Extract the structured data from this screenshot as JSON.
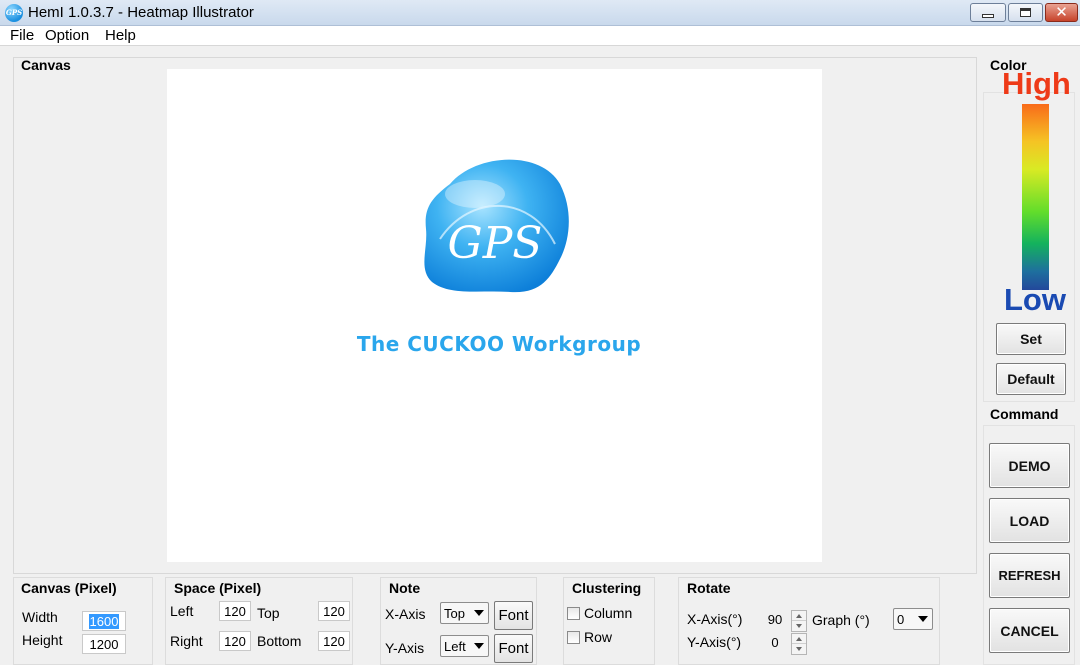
{
  "window": {
    "title": "HemI 1.0.3.7 - Heatmap Illustrator",
    "icon_text": "GPS",
    "close_glyph": "✕"
  },
  "menu": {
    "items": [
      {
        "label": "File"
      },
      {
        "label": "Option"
      },
      {
        "label": "Help"
      }
    ]
  },
  "canvas": {
    "title": "Canvas",
    "logo": {
      "initials": "GPS",
      "workgroup_text": "The CUCKOO Workgroup"
    }
  },
  "color": {
    "title": "Color",
    "high_label": "High",
    "low_label": "Low",
    "set_label": "Set",
    "default_label": "Default"
  },
  "command": {
    "title": "Command",
    "demo_label": "DEMO",
    "load_label": "LOAD",
    "refresh_label": "REFRESH",
    "cancel_label": "CANCEL"
  },
  "canvas_pixel": {
    "title": "Canvas (Pixel)",
    "width_label": "Width",
    "width_value": "1600",
    "height_label": "Height",
    "height_value": "1200"
  },
  "space_pixel": {
    "title": "Space (Pixel)",
    "left_label": "Left",
    "left_value": "120",
    "top_label": "Top",
    "top_value": "120",
    "right_label": "Right",
    "right_value": "120",
    "bottom_label": "Bottom",
    "bottom_value": "120"
  },
  "note": {
    "title": "Note",
    "x_axis_label": "X-Axis",
    "x_axis_value": "Top",
    "y_axis_label": "Y-Axis",
    "y_axis_value": "Left",
    "font_label": "Font"
  },
  "clustering": {
    "title": "Clustering",
    "column_label": "Column",
    "column_checked": false,
    "row_label": "Row",
    "row_checked": false
  },
  "rotate": {
    "title": "Rotate",
    "x_axis_label": "X-Axis(°)",
    "x_axis_value": "90",
    "y_axis_label": "Y-Axis(°)",
    "y_axis_value": "0",
    "graph_label": "Graph (°)",
    "graph_value": "0"
  },
  "colors": {
    "high": "#ee3a18",
    "low": "#1a4ab2",
    "logo_blue": "#2aa6ec"
  }
}
